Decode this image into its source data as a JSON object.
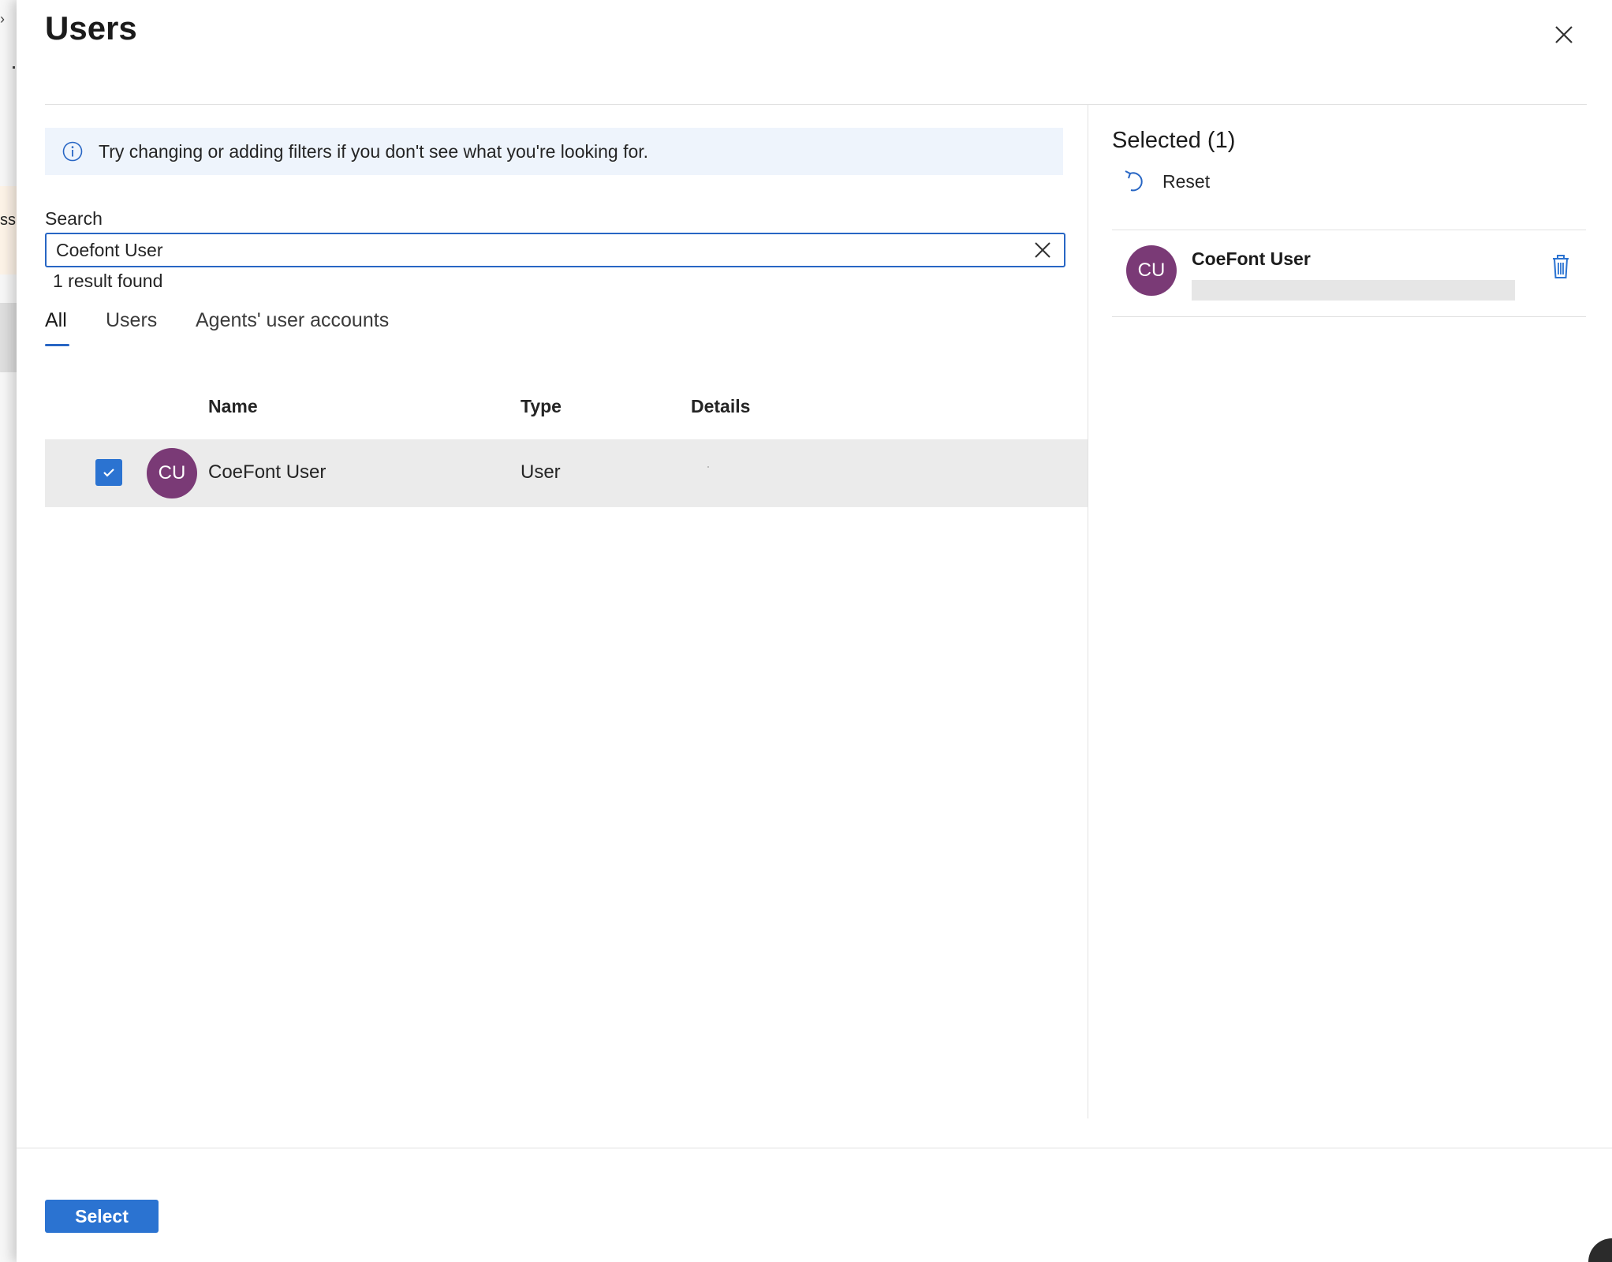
{
  "background": {
    "partial_text": "ssi"
  },
  "panel": {
    "title": "Users",
    "info_message": "Try changing or adding filters if you don't see what you're looking for."
  },
  "search": {
    "label": "Search",
    "value": "Coefont User",
    "result_count": "1 result found"
  },
  "tabs": [
    {
      "label": "All",
      "active": true
    },
    {
      "label": "Users",
      "active": false
    },
    {
      "label": "Agents' user accounts",
      "active": false
    }
  ],
  "table": {
    "columns": [
      "Name",
      "Type",
      "Details"
    ],
    "rows": [
      {
        "initials": "CU",
        "name": "CoeFont User",
        "type": "User",
        "details": "",
        "checked": true
      }
    ]
  },
  "selected": {
    "title": "Selected (1)",
    "reset_label": "Reset",
    "items": [
      {
        "initials": "CU",
        "name": "CoeFont User"
      }
    ]
  },
  "footer": {
    "select_label": "Select"
  },
  "colors": {
    "accent": "#2b73d1",
    "avatar": "#7a3a76",
    "info_bg": "#eef4fc",
    "row_selected_bg": "#ebebeb"
  },
  "icons": {
    "close": "close-icon",
    "info": "info-icon",
    "clear": "clear-search-icon",
    "reset": "undo-icon",
    "delete": "trash-icon",
    "check": "checkmark-icon"
  }
}
